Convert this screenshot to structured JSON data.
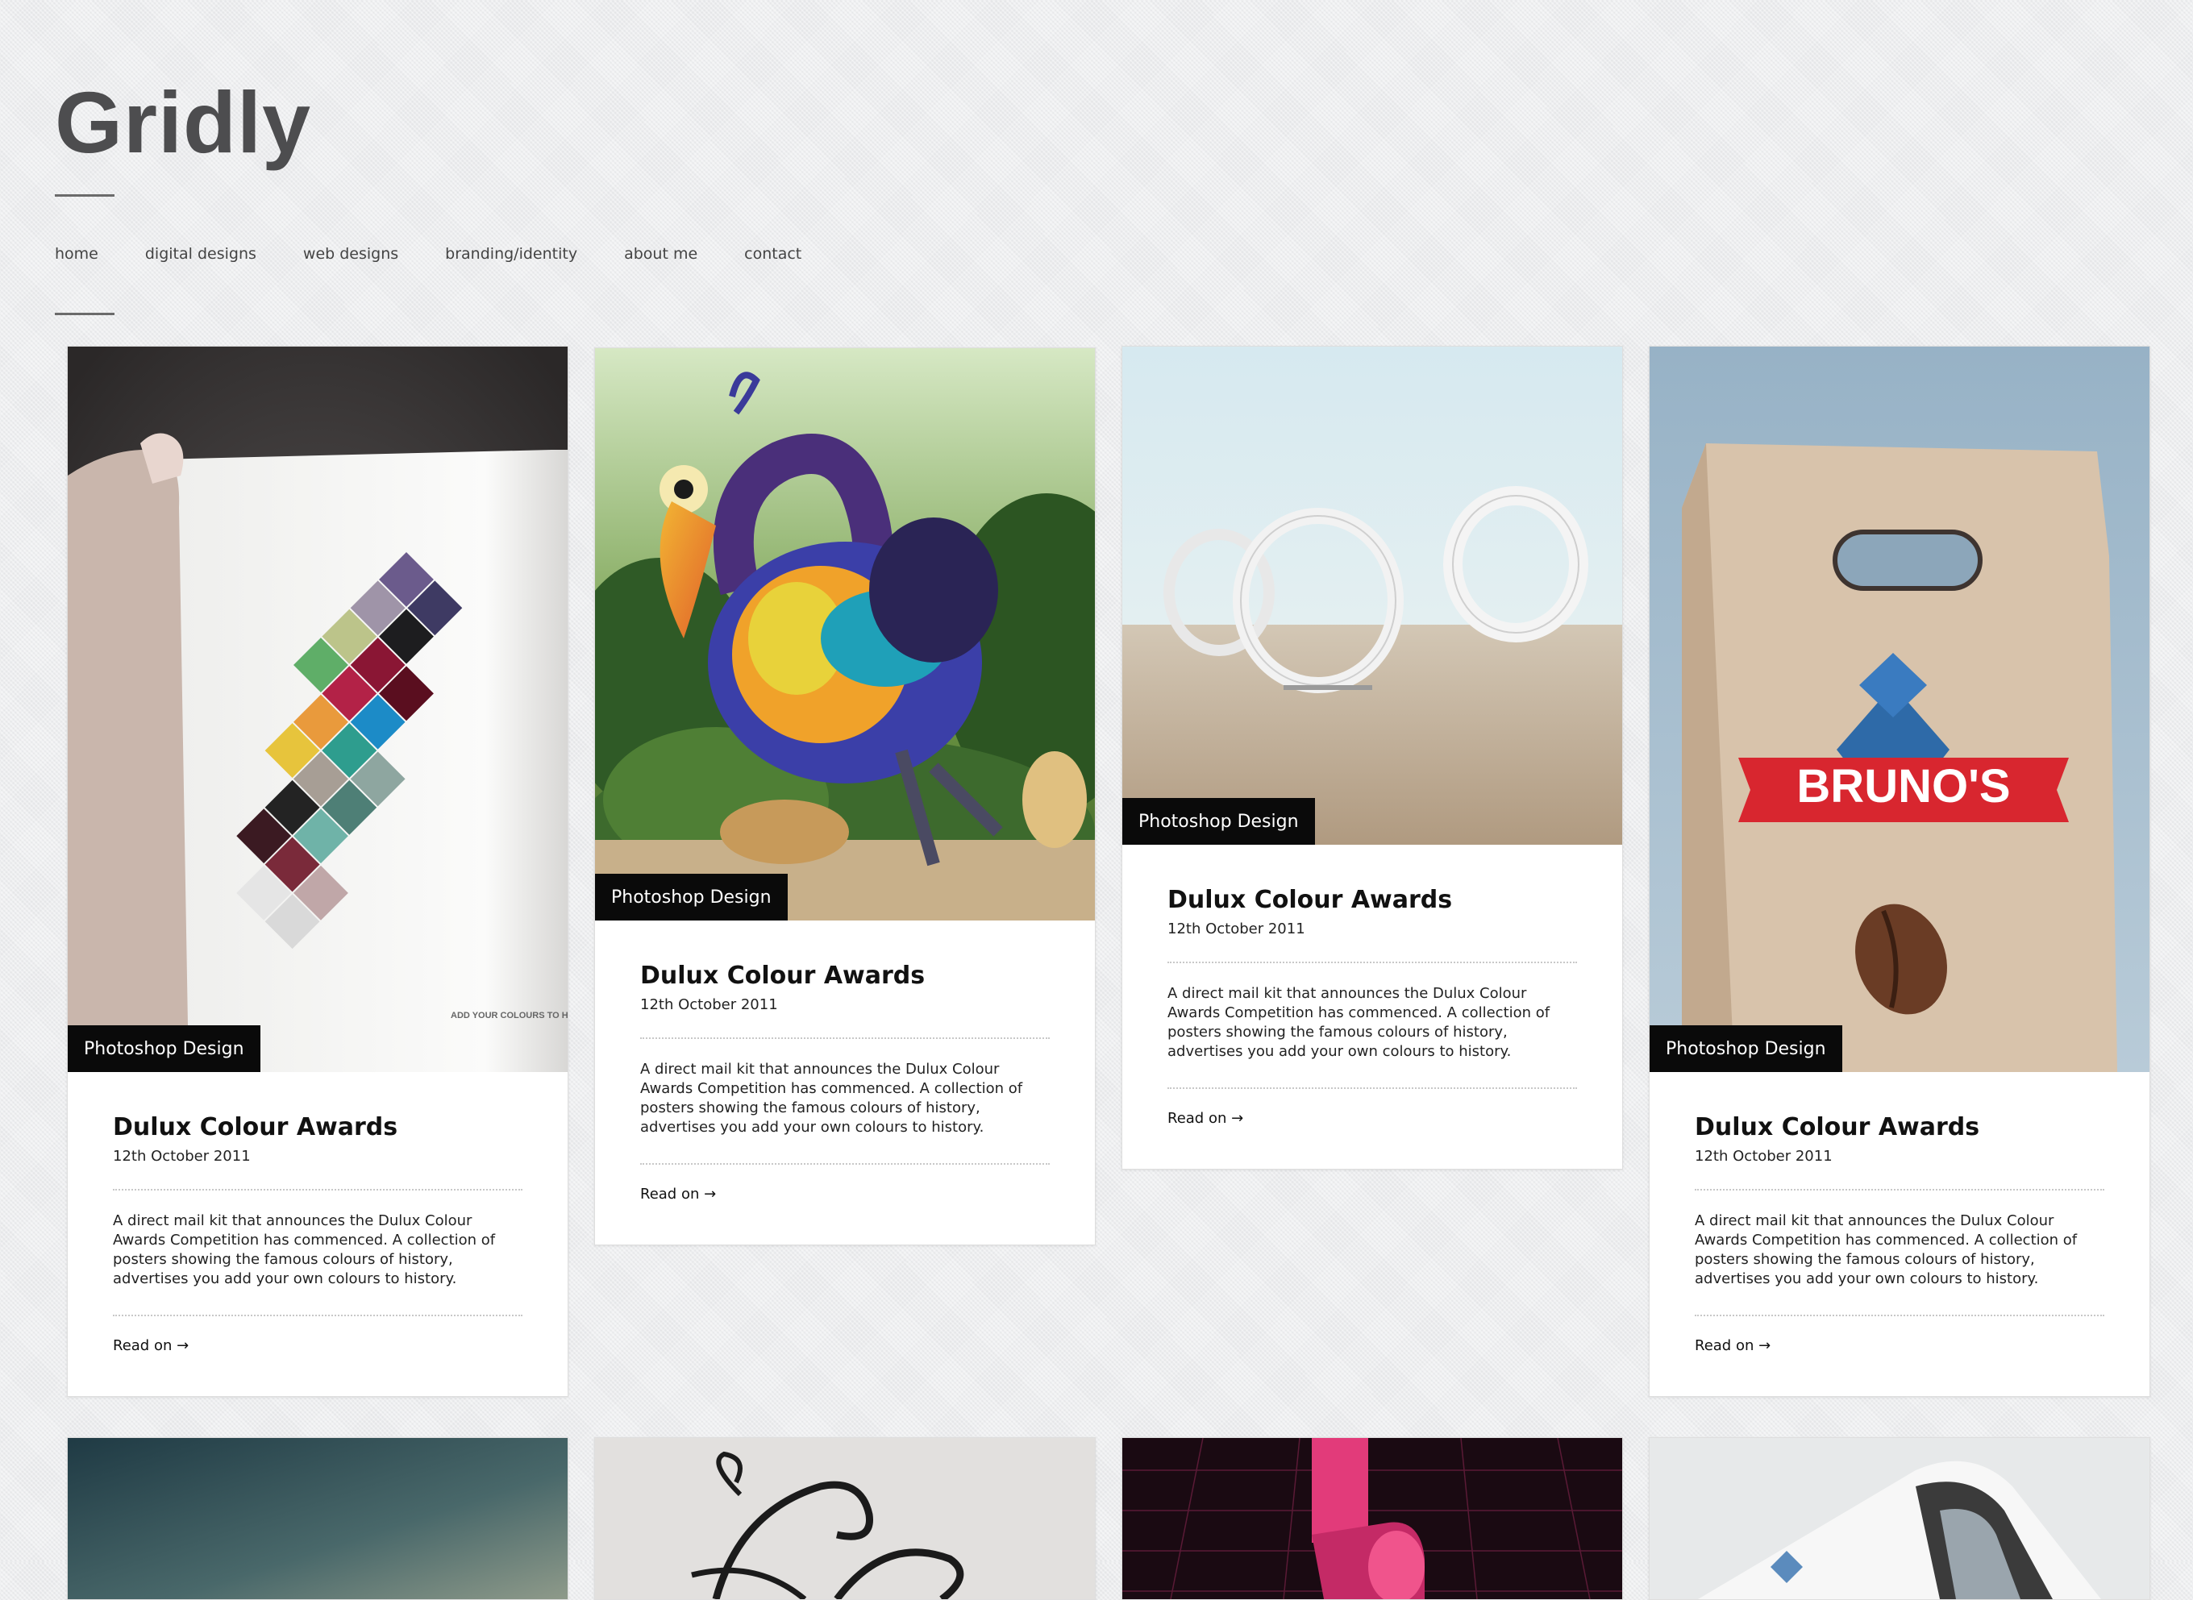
{
  "site": {
    "title": "Gridly"
  },
  "nav": {
    "items": [
      {
        "label": "home"
      },
      {
        "label": "digital designs"
      },
      {
        "label": "web designs"
      },
      {
        "label": "branding/identity"
      },
      {
        "label": "about me"
      },
      {
        "label": "contact"
      }
    ]
  },
  "posts": [
    {
      "category": "Photoshop Design",
      "title": "Dulux Colour Awards",
      "date": "12th October 2011",
      "excerpt": "A direct mail kit that announces the Dulux Colour Awards Competition has commenced. A collection of posters showing the famous colours of history, advertises you add your own colours to history.",
      "read_more": "Read on →",
      "image_caption": "ADD YOUR COLOURS TO HISTORY"
    },
    {
      "category": "Photoshop Design",
      "title": "Dulux Colour Awards",
      "date": "12th October 2011",
      "excerpt": "A direct mail kit that announces the Dulux Colour Awards Competition has commenced. A collection of posters showing the famous colours of history, advertises you add your own colours to history.",
      "read_more": "Read on →"
    },
    {
      "category": "Photoshop Design",
      "title": "Dulux Colour Awards",
      "date": "12th October 2011",
      "excerpt": "A direct mail kit that announces the Dulux Colour Awards Competition has commenced. A collection of posters showing the famous colours of history, advertises you add your own colours to history.",
      "read_more": "Read on →"
    },
    {
      "category": "Photoshop Design",
      "title": "Dulux Colour Awards",
      "date": "12th October 2011",
      "excerpt": "A direct mail kit that announces the Dulux Colour Awards Competition has commenced. A collection of posters showing the famous colours of history, advertises you add your own colours to history.",
      "read_more": "Read on →",
      "image_caption": "BRUNO'S"
    }
  ],
  "colors": {
    "tag_bg": "#0a0a0a",
    "logo": "#4d4d4f",
    "page_bg": "#ebecee"
  }
}
